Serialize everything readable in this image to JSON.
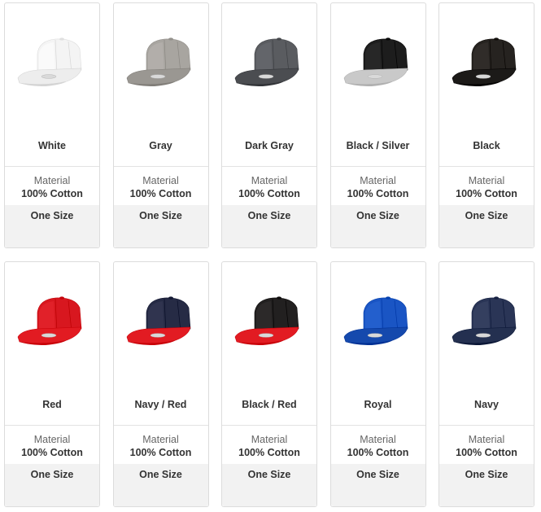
{
  "products": [
    {
      "name": "White",
      "material_label": "Material",
      "material": "100% Cotton",
      "size": "One Size",
      "crown_color": "#f4f4f4",
      "brim_color": "#ededed",
      "icon": "white-snapback-cap-icon"
    },
    {
      "name": "Gray",
      "material_label": "Material",
      "material": "100% Cotton",
      "size": "One Size",
      "crown_color": "#a8a5a0",
      "brim_color": "#9a9792",
      "icon": "gray-snapback-cap-icon"
    },
    {
      "name": "Dark Gray",
      "material_label": "Material",
      "material": "100% Cotton",
      "size": "One Size",
      "crown_color": "#5a5c60",
      "brim_color": "#4b4d51",
      "icon": "dark-gray-snapback-cap-icon"
    },
    {
      "name": "Black / Silver",
      "material_label": "Material",
      "material": "100% Cotton",
      "size": "One Size",
      "crown_color": "#1d1d1d",
      "brim_color": "#c9c9c9",
      "icon": "black-silver-snapback-cap-icon"
    },
    {
      "name": "Black",
      "material_label": "Material",
      "material": "100% Cotton",
      "size": "One Size",
      "crown_color": "#262320",
      "brim_color": "#1c1a18",
      "icon": "black-snapback-cap-icon"
    },
    {
      "name": "Red",
      "material_label": "Material",
      "material": "100% Cotton",
      "size": "One Size",
      "crown_color": "#d8171f",
      "brim_color": "#e21b22",
      "icon": "red-snapback-cap-icon"
    },
    {
      "name": "Navy / Red",
      "material_label": "Material",
      "material": "100% Cotton",
      "size": "One Size",
      "crown_color": "#262b45",
      "brim_color": "#e21b22",
      "icon": "navy-red-snapback-cap-icon"
    },
    {
      "name": "Black / Red",
      "material_label": "Material",
      "material": "100% Cotton",
      "size": "One Size",
      "crown_color": "#222020",
      "brim_color": "#e21b22",
      "icon": "black-red-snapback-cap-icon"
    },
    {
      "name": "Royal",
      "material_label": "Material",
      "material": "100% Cotton",
      "size": "One Size",
      "crown_color": "#1a55c4",
      "brim_color": "#1549ad",
      "icon": "royal-snapback-cap-icon"
    },
    {
      "name": "Navy",
      "material_label": "Material",
      "material": "100% Cotton",
      "size": "One Size",
      "crown_color": "#2a3556",
      "brim_color": "#243050",
      "icon": "navy-snapback-cap-icon"
    }
  ]
}
